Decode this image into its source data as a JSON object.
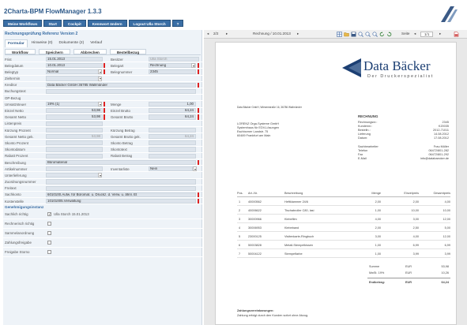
{
  "app": {
    "title": "2Charta-BPM FlowManager 1.3.3"
  },
  "menu": [
    "Meine Workflows",
    "Start",
    "Cockpit",
    "Kennwort ändern",
    "Logout Ulla Storch",
    "?"
  ],
  "left": {
    "section_title": "Rechnungsprüfung Referenz Version 2",
    "tabs": [
      "Formular",
      "Hinweise (0)",
      "Dokumente (2)",
      "Verlauf"
    ],
    "subtabs": [
      "Workflow",
      "Speichern",
      "Abbrechen",
      "Bestellbezug"
    ],
    "fields": {
      "frist": {
        "label": "Frist",
        "value": "15.01.2013",
        "label2": "Besitzer",
        "value2": "Ulla Storch"
      },
      "belegdatum": {
        "label": "Belegdatum",
        "value": "10.01.2013",
        "label2": "Belegart",
        "value2": "Rechnung"
      },
      "belegtyp": {
        "label": "Belegtyp",
        "value": "Normal",
        "label2": "Belegnummer",
        "value2": "2345"
      },
      "zielternin": {
        "label": "Zieltermin",
        "value": ""
      },
      "kreditor": {
        "label": "Kreditor",
        "value": "Data Bäcker GmbH 36785 Wallmünder"
      },
      "buchungstext": {
        "label": "Buchungstext",
        "value": ""
      },
      "opbezug": {
        "label": "OP-Bezug",
        "value": ""
      },
      "umsatzsteuer": {
        "label": "Umsatzsteuer",
        "value": "19% (1)",
        "label2": "Menge",
        "value2": "1,00"
      },
      "einzelnetto": {
        "label": "Einzel Netto",
        "value": "53,98",
        "label2": "Einzel Brutto",
        "value2": "64,24"
      },
      "gesamtnetto": {
        "label": "Gesamt Netto",
        "value": "53,98",
        "label2": "Gesamt Brutto",
        "value2": "64,24"
      },
      "listenpreis": {
        "label": "Listenpreis",
        "value": ""
      },
      "kuerzungprozent": {
        "label": "Kürzung Prozent",
        "value": "",
        "label2": "Kürzung Betrag",
        "value2": ""
      },
      "gesamtnettogek": {
        "label": "Gesamt Netto gek.",
        "value": "53,98",
        "label2": "Gesamt Brutto gek.",
        "value2": "64,24"
      },
      "skontoprozent": {
        "label": "Skonto Prozent",
        "value": "",
        "label2": "Skonto Betrag",
        "value2": ""
      },
      "skontodatum": {
        "label": "Skontodatum",
        "value": "",
        "label2": "Skontotext",
        "value2": ""
      },
      "rabattprozent": {
        "label": "Rabatt Prozent",
        "value": "",
        "label2": "Rabatt Betrag",
        "value2": ""
      },
      "beschreibung": {
        "label": "Beschreibung",
        "value": "Büromaterial"
      },
      "artikelnummer": {
        "label": "Artikelnummer",
        "value": "",
        "label2": "Inventarliste",
        "value2": "Nein"
      },
      "unterlieferung": {
        "label": "Unterlieferung",
        "value": ""
      },
      "zuordnungsnummer": {
        "label": "Zuordnungsnummer",
        "value": ""
      },
      "freitext": {
        "label": "Freitext",
        "value": ""
      },
      "sachkonto": {
        "label": "Sachkonto",
        "value": "6010100.Aufw. für Büromat. u. Druckz. d. Verw. u. ähnl. Et"
      },
      "kostenstelle": {
        "label": "Kostenstelle",
        "value": "10101005.Verwaltung"
      }
    },
    "approval_head": "Genehmigungsinstanz",
    "checks": [
      {
        "label": "Sachlich richtig",
        "checked": true,
        "note": "Ulla Storch 15.01.2013"
      },
      {
        "label": "Rechnerisch richtig",
        "checked": false,
        "note": ""
      },
      {
        "label": "Sammelanordnung",
        "checked": false,
        "note": ""
      },
      {
        "label": "Zahlungsfreigabe",
        "checked": false,
        "note": ""
      },
      {
        "label": "Freigabe Storno",
        "checked": false,
        "note": ""
      }
    ]
  },
  "viewer": {
    "page": "2/2",
    "docname": "Rechnung / 10.01.2013",
    "zoom_label": "Seite",
    "zoom_value": "1/1"
  },
  "invoice": {
    "brand": "Data Bäcker",
    "brand_sub": "Der Druckerspezialist",
    "sender_line": "Data Bäcker GmbH, Wiesenstraße 16, 36786 Wallmünder",
    "recipient": [
      "LORENZ Orga-Systeme GmbH",
      "Systemhaus für EDV-Lösungen",
      "Eschborner Landstr. 75",
      "60489 Frankfurt am Main"
    ],
    "doc_title": "RECHNUNG",
    "meta": [
      {
        "k": "Rechnungsnr.:",
        "v": "2345"
      },
      {
        "k": "Kundennr.:",
        "v": "K20035"
      },
      {
        "k": "Bestelln.:",
        "v": "2012-71011"
      },
      {
        "k": "Lieferung",
        "v": "14.08.2012"
      },
      {
        "k": "Datum:",
        "v": "17.08.2012"
      }
    ],
    "contact": [
      {
        "k": "Sachbearbeiter",
        "v": "Frau Müller"
      },
      {
        "k": "Telefon",
        "v": "06472/801-282"
      },
      {
        "k": "Fax",
        "v": "06472/801-292"
      },
      {
        "k": "E-Mail",
        "v": "info@databaecker.de"
      }
    ],
    "columns": [
      "Pos.",
      "Art.-Nr.",
      "Beschreibung",
      "Menge",
      "Einzelpreis",
      "Gesamtpreis"
    ],
    "items": [
      [
        "1",
        "40000562",
        "Heftklammer 24/6",
        "2,00",
        "2,00",
        "4,00"
      ],
      [
        "2",
        "40006622",
        "Tischabroller C80, lasi",
        "1,00",
        "10,00",
        "10,00"
      ],
      [
        "3",
        "30000966",
        "Klebefilm",
        "4,00",
        "3,00",
        "12,00"
      ],
      [
        "4",
        "30006953",
        "Klebeband",
        "2,00",
        "2,50",
        "5,00"
      ],
      [
        "5",
        "23000125",
        "Visitenkarte-Ringbuch",
        "3,00",
        "4,00",
        "12,00"
      ],
      [
        "6",
        "50003828",
        "Metall-Stempelkissen",
        "1,00",
        "6,99",
        "6,99"
      ],
      [
        "7",
        "50004122",
        "Stempelfarbe",
        "1,00",
        "3,99",
        "3,99"
      ]
    ],
    "sum_label": "Summe",
    "sum_cur": "EUR",
    "sum_val": "53,98",
    "tax_label": "MwSt. 19%",
    "tax_cur": "EUR",
    "tax_val": "10,26",
    "total_label": "Endbetrag:",
    "total_cur": "EUR",
    "total_val": "64,24",
    "payment_head": "Zahlungsvereinbarungen:",
    "payment_text": "Zahlung erfolgt durch den Kunden sofort ohne Abzug."
  },
  "colors": {
    "accent": "#3a6ea5",
    "required": "#d22222",
    "brand": "#1c3f73"
  }
}
